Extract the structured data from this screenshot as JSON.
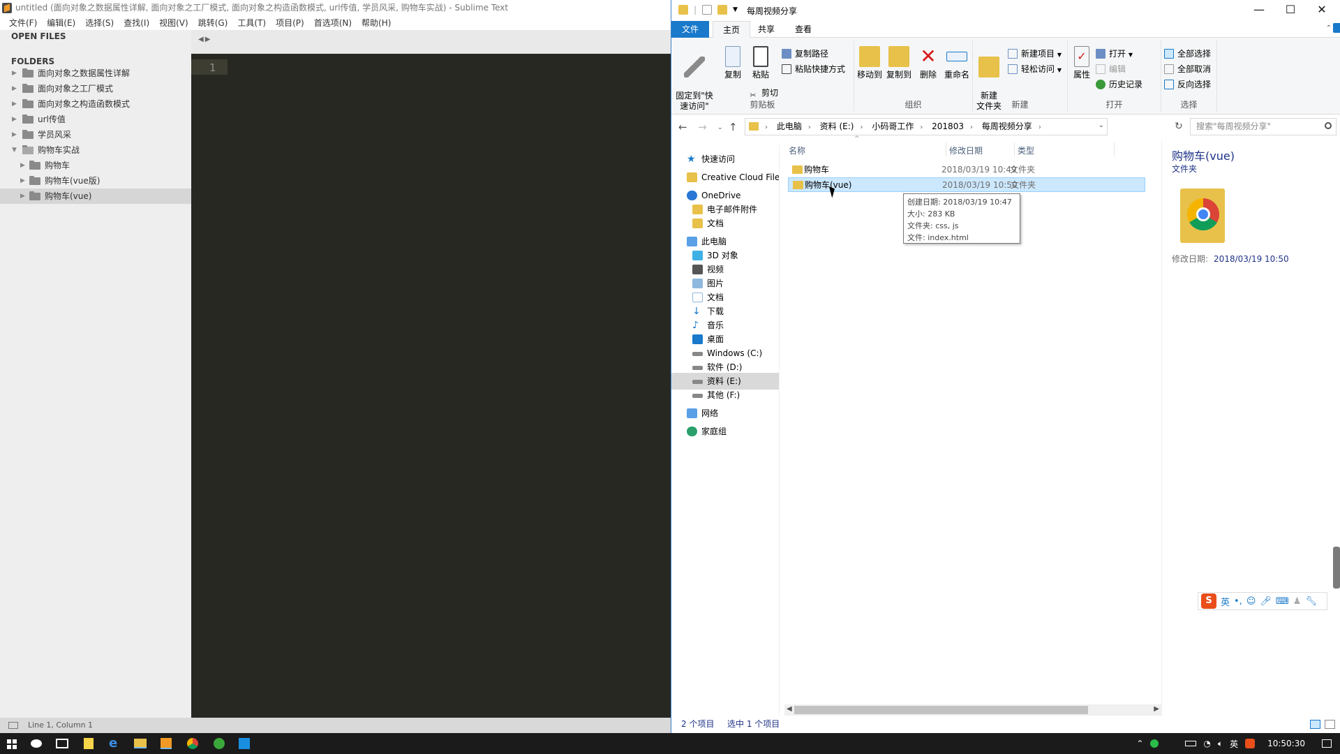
{
  "sublime": {
    "title": "untitled (面向对象之数据属性详解, 面向对象之工厂模式, 面向对象之构造函数模式, url传值, 学员风采, 购物车实战) - Sublime Text",
    "menu": [
      "文件(F)",
      "编辑(E)",
      "选择(S)",
      "查找(I)",
      "视图(V)",
      "跳转(G)",
      "工具(T)",
      "项目(P)",
      "首选项(N)",
      "帮助(H)"
    ],
    "open_files_header": "OPEN FILES",
    "folders_header": "FOLDERS",
    "tree": [
      "面向对象之数据属性详解",
      "面向对象之工厂模式",
      "面向对象之构造函数模式",
      "url传值",
      "学员风采",
      "购物车实战",
      "购物车",
      "购物车(vue版)",
      "购物车(vue)"
    ],
    "line_number": "1",
    "status": "Line 1, Column 1"
  },
  "explorer": {
    "title": "每周视频分享",
    "window_controls": {
      "minimize": "—",
      "maximize": "☐",
      "close": "✕"
    },
    "ribbon_tabs": [
      "文件",
      "主页",
      "共享",
      "查看"
    ],
    "clipboard": {
      "pin": "固定到\"快\n速访问\"",
      "copy": "复制",
      "paste": "粘贴",
      "copy_path": "复制路径",
      "paste_shortcut": "粘贴快捷方式",
      "cut": "剪切",
      "label": "剪贴板"
    },
    "organize": {
      "move_to": "移动到",
      "copy_to": "复制到",
      "delete": "删除",
      "rename": "重命名",
      "label": "组织"
    },
    "new": {
      "new_folder": "新建\n文件夹",
      "new_item": "新建项目",
      "easy_access": "轻松访问",
      "label": "新建"
    },
    "open": {
      "properties": "属性",
      "open": "打开",
      "edit": "编辑",
      "history": "历史记录",
      "label": "打开"
    },
    "select": {
      "select_all": "全部选择",
      "select_none": "全部取消",
      "invert": "反向选择",
      "label": "选择"
    },
    "breadcrumb": [
      "此电脑",
      "资料 (E:)",
      "小码哥工作",
      "201803",
      "每周视频分享"
    ],
    "search_placeholder": "搜索\"每周视频分享\"",
    "nav": [
      "快速访问",
      "Creative Cloud Files",
      "OneDrive",
      "电子邮件附件",
      "文档",
      "此电脑",
      "3D 对象",
      "视频",
      "图片",
      "文档",
      "下载",
      "音乐",
      "桌面",
      "Windows (C:)",
      "软件 (D:)",
      "资料 (E:)",
      "其他 (F:)",
      "网络",
      "家庭组"
    ],
    "columns": {
      "name": "名称",
      "date": "修改日期",
      "type": "类型"
    },
    "files": [
      {
        "name": "购物车",
        "date": "2018/03/19 10:49",
        "type": "文件夹"
      },
      {
        "name": "购物车(vue)",
        "date": "2018/03/19 10:50",
        "type": "文件夹"
      }
    ],
    "tooltip": [
      "创建日期: 2018/03/19 10:47",
      "大小: 283 KB",
      "文件夹: css, js",
      "文件: index.html"
    ],
    "preview": {
      "name": "购物车(vue)",
      "type": "文件夹",
      "modified_label": "修改日期:",
      "modified_value": "2018/03/19 10:50"
    },
    "status_count": "2 个项目",
    "status_selected": "选中 1 个项目"
  },
  "ime": {
    "logo": "S",
    "mode": "英"
  },
  "taskbar": {
    "ime_lang": "英",
    "clock": "10:50:30"
  },
  "colors": {
    "accent": "#1979ca",
    "editor_bg": "#272822",
    "selection": "#cce8ff",
    "folder": "#e8c14a"
  }
}
